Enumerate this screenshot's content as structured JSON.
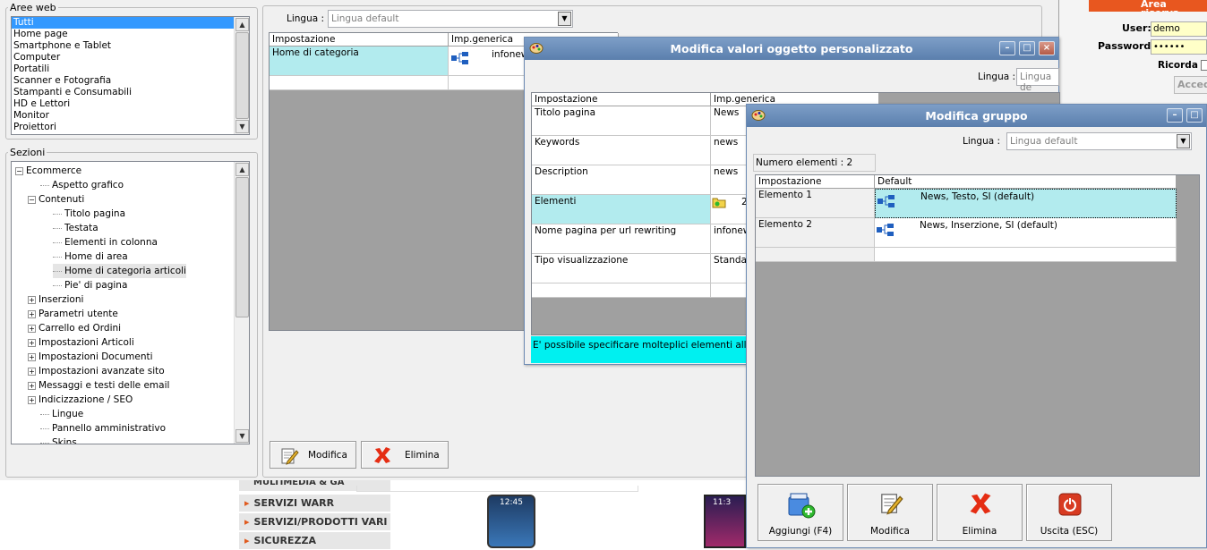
{
  "main": {
    "aree_web": {
      "legend": "Aree web",
      "items": [
        "Tutti",
        "Home page",
        "Smartphone e Tablet",
        "Computer",
        "Portatili",
        "Scanner e Fotografia",
        "Stampanti e Consumabili",
        "HD e Lettori",
        "Monitor",
        "Proiettori"
      ],
      "selected": "Tutti"
    },
    "sezioni": {
      "legend": "Sezioni",
      "tree": [
        {
          "label": "Ecommerce",
          "expander": "−"
        },
        {
          "label": "Aspetto grafico",
          "expander": ""
        },
        {
          "label": "Contenuti",
          "expander": "−"
        },
        {
          "label": "Titolo pagina",
          "expander": ""
        },
        {
          "label": "Testata",
          "expander": ""
        },
        {
          "label": "Elementi in colonna",
          "expander": ""
        },
        {
          "label": "Home di area",
          "expander": ""
        },
        {
          "label": "Home di categoria articoli",
          "expander": ""
        },
        {
          "label": "Pie' di pagina",
          "expander": ""
        },
        {
          "label": "Inserzioni",
          "expander": "+"
        },
        {
          "label": "Parametri utente",
          "expander": "+"
        },
        {
          "label": "Carrello ed Ordini",
          "expander": "+"
        },
        {
          "label": "Impostazioni Articoli",
          "expander": "+"
        },
        {
          "label": "Impostazioni Documenti",
          "expander": "+"
        },
        {
          "label": "Impostazioni avanzate sito",
          "expander": "+"
        },
        {
          "label": "Messaggi e testi delle email",
          "expander": "+"
        },
        {
          "label": "Indicizzazione / SEO",
          "expander": "+"
        },
        {
          "label": "Lingue",
          "expander": ""
        },
        {
          "label": "Pannello amministrativo",
          "expander": ""
        },
        {
          "label": "Skins",
          "expander": ""
        }
      ]
    },
    "lingua_label": "Lingua :",
    "lingua_value": "Lingua default",
    "grid": {
      "headers": [
        "Impostazione",
        "Imp.generica"
      ],
      "rows": [
        {
          "impostazione": "Home di categoria",
          "value": "infonew"
        }
      ]
    },
    "buttons": {
      "modifica": "Modifica",
      "elimina": "Elimina"
    }
  },
  "win1": {
    "title": "Modifica valori oggetto personalizzato",
    "lingua_label": "Lingua :",
    "lingua_value": "Lingua de",
    "headers": [
      "Impostazione",
      "Imp.generica"
    ],
    "rows": [
      {
        "impostazione": "Titolo pagina",
        "value": "News"
      },
      {
        "impostazione": "Keywords",
        "value": "news"
      },
      {
        "impostazione": "Description",
        "value": "news"
      },
      {
        "impostazione": "Elementi",
        "value": "2"
      },
      {
        "impostazione": "Nome pagina per url rewriting",
        "value": "infonew"
      },
      {
        "impostazione": "Tipo visualizzazione",
        "value": "Standar"
      }
    ],
    "hint": "E' possibile specificare molteplici elementi all'interno"
  },
  "win2": {
    "title": "Modifica gruppo",
    "lingua_label": "Lingua :",
    "lingua_value": "Lingua default",
    "count_label": "Numero elementi : 2",
    "headers": [
      "Impostazione",
      "Default"
    ],
    "rows": [
      {
        "impostazione": "Elemento 1",
        "value": "News, Testo, SI (default)"
      },
      {
        "impostazione": "Elemento 2",
        "value": "News, Inserzione, SI (default)"
      }
    ],
    "buttons": {
      "aggiungi": "Aggiungi (F4)",
      "modifica": "Modifica",
      "elimina": "Elimina",
      "uscita": "Uscita (ESC)"
    }
  },
  "reserved": {
    "title": "Area riserva",
    "user_label": "User:",
    "user_value": "demo",
    "password_label": "Password:",
    "password_value": "••••••",
    "ricorda": "Ricorda",
    "accedi": "Acced"
  },
  "site_menu": [
    "MULTIMEDIA & GA",
    "SERVIZI WARR",
    "SERVIZI/PRODOTTI VARI",
    "SICUREZZA"
  ],
  "phone_time": "12:45",
  "phone_time2": "11:3"
}
